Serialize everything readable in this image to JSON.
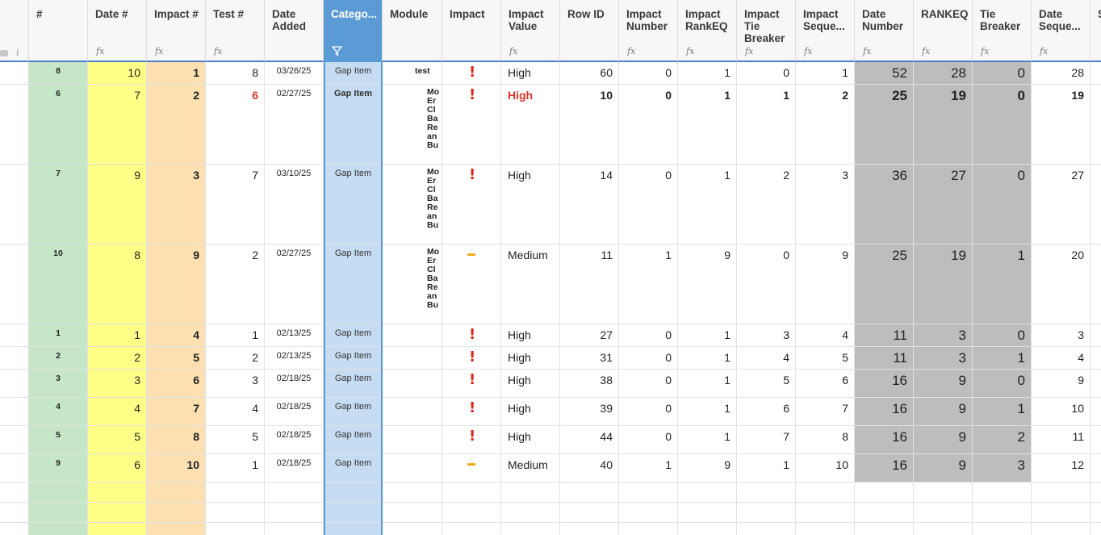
{
  "columns": [
    {
      "key": "num",
      "label": "#",
      "formula": false,
      "theme": "green"
    },
    {
      "key": "date_num",
      "label": "Date #",
      "formula": true,
      "theme": "yellow"
    },
    {
      "key": "impact_num",
      "label": "Impact #",
      "formula": true,
      "theme": "orange"
    },
    {
      "key": "test_num",
      "label": "Test #",
      "formula": true,
      "theme": ""
    },
    {
      "key": "date_added",
      "label": "Date Added",
      "formula": false,
      "theme": ""
    },
    {
      "key": "category",
      "label": "Catego...",
      "formula": false,
      "theme": "blue"
    },
    {
      "key": "module",
      "label": "Module",
      "formula": false,
      "theme": ""
    },
    {
      "key": "impact",
      "label": "Impact",
      "formula": false,
      "theme": ""
    },
    {
      "key": "impact_value",
      "label": "Impact Value",
      "formula": true,
      "theme": ""
    },
    {
      "key": "row_id",
      "label": "Row ID",
      "formula": false,
      "theme": ""
    },
    {
      "key": "impact_number",
      "label": "Impact Number",
      "formula": true,
      "theme": ""
    },
    {
      "key": "impact_rankeq",
      "label": "Impact RankEQ",
      "formula": true,
      "theme": ""
    },
    {
      "key": "impact_tie",
      "label": "Impact Tie Breaker",
      "formula": true,
      "theme": ""
    },
    {
      "key": "impact_seq",
      "label": "Impact Seque...",
      "formula": true,
      "theme": ""
    },
    {
      "key": "date_number",
      "label": "Date Number",
      "formula": true,
      "theme": ""
    },
    {
      "key": "rankeq",
      "label": "RANKEQ",
      "formula": true,
      "theme": ""
    },
    {
      "key": "tie_breaker",
      "label": "Tie Breaker",
      "formula": true,
      "theme": ""
    },
    {
      "key": "date_seq",
      "label": "Date Seque...",
      "formula": true,
      "theme": ""
    },
    {
      "key": "last",
      "label": "S r",
      "formula": false,
      "theme": ""
    }
  ],
  "icons": {
    "formula": "fx",
    "filter": "filter-icon",
    "comment": "i"
  },
  "colors": {
    "green": "#c6e6c8",
    "yellow": "#ffff88",
    "orange": "#fddfb0",
    "blue": "#c6dcf2",
    "selected_header": "#5b9bd5",
    "gray": "#bdbdbd",
    "high": "#d9271e",
    "medium": "#f1a91b"
  },
  "rows": [
    {
      "num": "8",
      "date_num": "10",
      "impact_num": "1",
      "test_num": "8",
      "date_added": "03/26/25",
      "category": "Gap Item",
      "module": "test",
      "impact": "high",
      "impact_value": "High",
      "row_id": "60",
      "impact_number": "0",
      "impact_rankeq": "1",
      "impact_tie": "0",
      "impact_seq": "1",
      "date_number": "52",
      "rankeq": "28",
      "tie_breaker": "0",
      "date_seq": "28",
      "bold": false
    },
    {
      "num": "6",
      "date_num": "7",
      "impact_num": "2",
      "test_num": "6",
      "date_added": "02/27/25",
      "category": "Gap Item",
      "module": "Mo\nEr\nCl\nBa\nRe\nan\nBu",
      "impact": "high",
      "impact_value": "High",
      "row_id": "10",
      "impact_number": "0",
      "impact_rankeq": "1",
      "impact_tie": "1",
      "impact_seq": "2",
      "date_number": "25",
      "rankeq": "19",
      "tie_breaker": "0",
      "date_seq": "19",
      "bold": true
    },
    {
      "num": "7",
      "date_num": "9",
      "impact_num": "3",
      "test_num": "7",
      "date_added": "03/10/25",
      "category": "Gap Item",
      "module": "Mo\nEr\nCl\nBa\nRe\nan\nBu",
      "impact": "high",
      "impact_value": "High",
      "row_id": "14",
      "impact_number": "0",
      "impact_rankeq": "1",
      "impact_tie": "2",
      "impact_seq": "3",
      "date_number": "36",
      "rankeq": "27",
      "tie_breaker": "0",
      "date_seq": "27",
      "bold": false
    },
    {
      "num": "10",
      "date_num": "8",
      "impact_num": "9",
      "test_num": "2",
      "date_added": "02/27/25",
      "category": "Gap Item",
      "module": "Mo\nEr\nCl\nBa\nRe\nan\nBu",
      "impact": "medium",
      "impact_value": "Medium",
      "row_id": "11",
      "impact_number": "1",
      "impact_rankeq": "9",
      "impact_tie": "0",
      "impact_seq": "9",
      "date_number": "25",
      "rankeq": "19",
      "tie_breaker": "1",
      "date_seq": "20",
      "bold": false
    },
    {
      "num": "1",
      "date_num": "1",
      "impact_num": "4",
      "test_num": "1",
      "date_added": "02/13/25",
      "category": "Gap Item",
      "module": "",
      "impact": "high",
      "impact_value": "High",
      "row_id": "27",
      "impact_number": "0",
      "impact_rankeq": "1",
      "impact_tie": "3",
      "impact_seq": "4",
      "date_number": "11",
      "rankeq": "3",
      "tie_breaker": "0",
      "date_seq": "3",
      "bold": false
    },
    {
      "num": "2",
      "date_num": "2",
      "impact_num": "5",
      "test_num": "2",
      "date_added": "02/13/25",
      "category": "Gap Item",
      "module": "",
      "impact": "high",
      "impact_value": "High",
      "row_id": "31",
      "impact_number": "0",
      "impact_rankeq": "1",
      "impact_tie": "4",
      "impact_seq": "5",
      "date_number": "11",
      "rankeq": "3",
      "tie_breaker": "1",
      "date_seq": "4",
      "bold": false
    },
    {
      "num": "3",
      "date_num": "3",
      "impact_num": "6",
      "test_num": "3",
      "date_added": "02/18/25",
      "category": "Gap Item",
      "module": "",
      "impact": "high",
      "impact_value": "High",
      "row_id": "38",
      "impact_number": "0",
      "impact_rankeq": "1",
      "impact_tie": "5",
      "impact_seq": "6",
      "date_number": "16",
      "rankeq": "9",
      "tie_breaker": "0",
      "date_seq": "9",
      "bold": false
    },
    {
      "num": "4",
      "date_num": "4",
      "impact_num": "7",
      "test_num": "4",
      "date_added": "02/18/25",
      "category": "Gap Item",
      "module": "",
      "impact": "high",
      "impact_value": "High",
      "row_id": "39",
      "impact_number": "0",
      "impact_rankeq": "1",
      "impact_tie": "6",
      "impact_seq": "7",
      "date_number": "16",
      "rankeq": "9",
      "tie_breaker": "1",
      "date_seq": "10",
      "bold": false
    },
    {
      "num": "5",
      "date_num": "5",
      "impact_num": "8",
      "test_num": "5",
      "date_added": "02/18/25",
      "category": "Gap Item",
      "module": "",
      "impact": "high",
      "impact_value": "High",
      "row_id": "44",
      "impact_number": "0",
      "impact_rankeq": "1",
      "impact_tie": "7",
      "impact_seq": "8",
      "date_number": "16",
      "rankeq": "9",
      "tie_breaker": "2",
      "date_seq": "11",
      "bold": false
    },
    {
      "num": "9",
      "date_num": "6",
      "impact_num": "10",
      "test_num": "1",
      "date_added": "02/18/25",
      "category": "Gap Item",
      "module": "",
      "impact": "medium",
      "impact_value": "Medium",
      "row_id": "40",
      "impact_number": "1",
      "impact_rankeq": "9",
      "impact_tie": "1",
      "impact_seq": "10",
      "date_number": "16",
      "rankeq": "9",
      "tie_breaker": "3",
      "date_seq": "12",
      "bold": false
    }
  ]
}
